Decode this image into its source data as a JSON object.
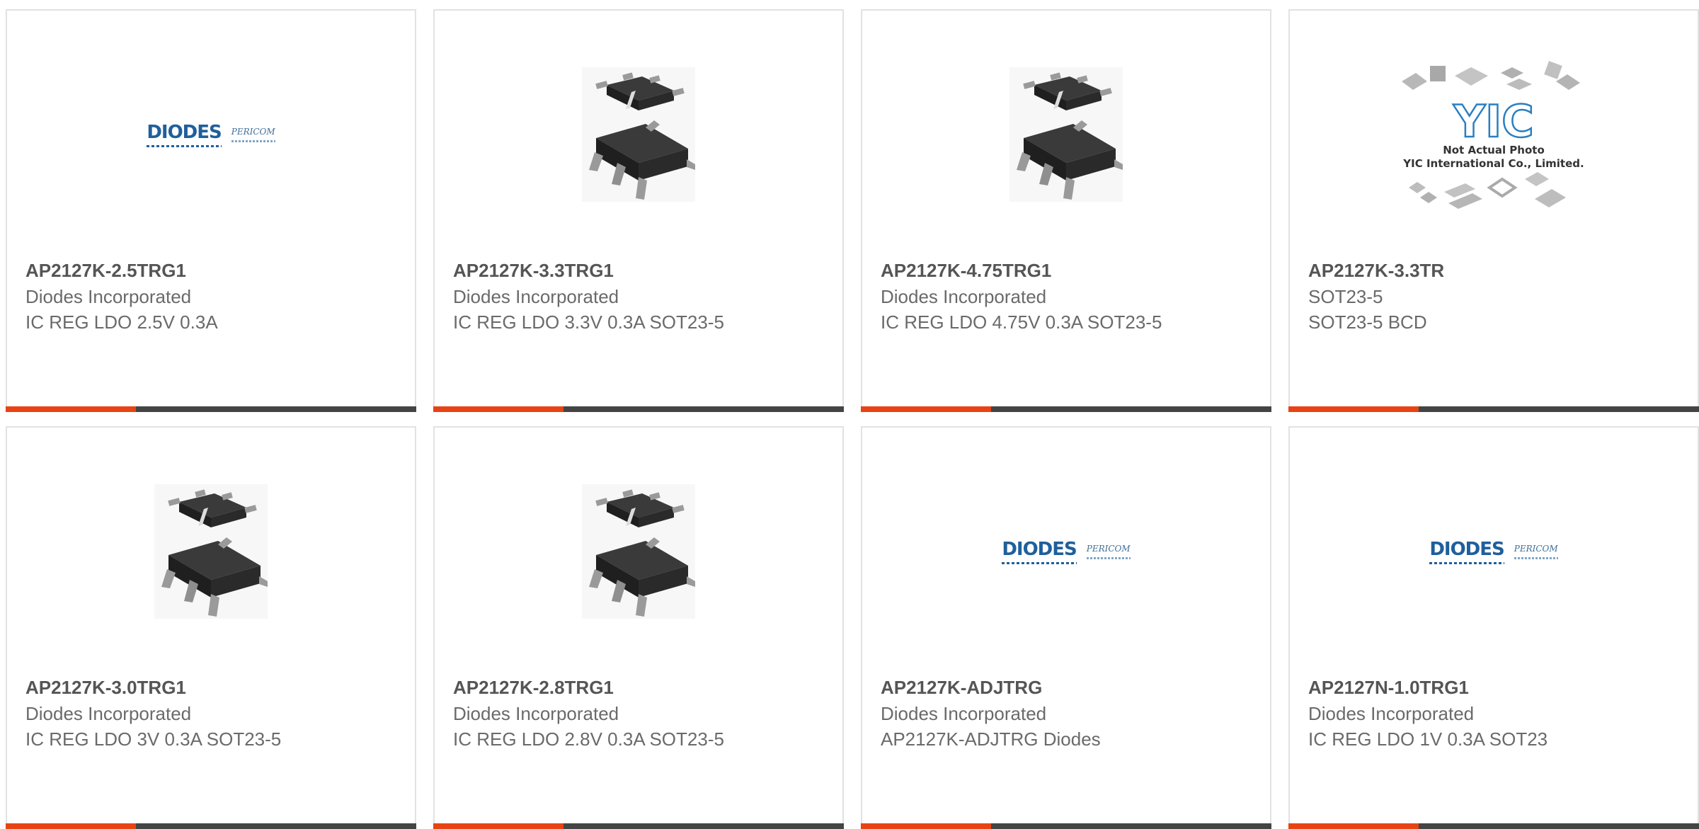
{
  "colors": {
    "accent": "#e84314",
    "bar": "#444444",
    "border": "#e2e2e2",
    "part_number": "#555555",
    "text": "#6a6a6a",
    "diodes_blue": "#1f5f9c"
  },
  "products": [
    {
      "part_number": "AP2127K-2.5TRG1",
      "manufacturer": "Diodes Incorporated",
      "description": "IC REG LDO 2.5V 0.3A",
      "image": "diodes-pericom-logo",
      "logo": {
        "brand": "DIODES",
        "partner": "PERICOM"
      }
    },
    {
      "part_number": "AP2127K-3.3TRG1",
      "manufacturer": "Diodes Incorporated",
      "description": "IC REG LDO 3.3V 0.3A SOT23-5",
      "image": "sot23-5-package"
    },
    {
      "part_number": "AP2127K-4.75TRG1",
      "manufacturer": "Diodes Incorporated",
      "description": "IC REG LDO 4.75V 0.3A SOT23-5",
      "image": "sot23-5-package"
    },
    {
      "part_number": "AP2127K-3.3TR",
      "manufacturer": "SOT23-5",
      "description": "SOT23-5 BCD",
      "image": "yic-placeholder",
      "placeholder": {
        "logo": "YIC",
        "line1": "Not Actual Photo",
        "line2": "YIC International Co., Limited."
      }
    },
    {
      "part_number": "AP2127K-3.0TRG1",
      "manufacturer": "Diodes Incorporated",
      "description": "IC REG LDO 3V 0.3A SOT23-5",
      "image": "sot23-5-package"
    },
    {
      "part_number": "AP2127K-2.8TRG1",
      "manufacturer": "Diodes Incorporated",
      "description": "IC REG LDO 2.8V 0.3A SOT23-5",
      "image": "sot23-5-package"
    },
    {
      "part_number": "AP2127K-ADJTRG",
      "manufacturer": "Diodes Incorporated",
      "description": "AP2127K-ADJTRG Diodes",
      "image": "diodes-pericom-logo",
      "logo": {
        "brand": "DIODES",
        "partner": "PERICOM"
      }
    },
    {
      "part_number": "AP2127N-1.0TRG1",
      "manufacturer": "Diodes Incorporated",
      "description": "IC REG LDO 1V 0.3A SOT23",
      "image": "diodes-pericom-logo",
      "logo": {
        "brand": "DIODES",
        "partner": "PERICOM"
      }
    }
  ]
}
